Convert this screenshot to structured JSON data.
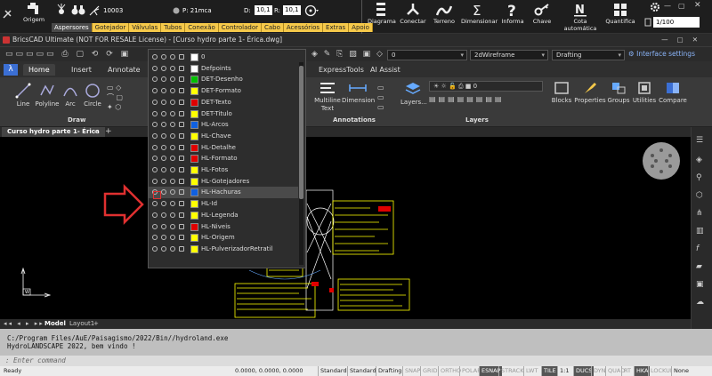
{
  "topbar": {
    "origem": "Origem",
    "counter": "10003",
    "pressure": "P: 21mca",
    "d_label": "D:",
    "d_value": "10,1",
    "r_label": "R:",
    "r_value": "10,1",
    "menus": [
      "Aspersores",
      "Gotejador",
      "Válvulas",
      "Tubos",
      "Conexão",
      "Controlador",
      "Cabo",
      "Acessórios",
      "Extras",
      "Apoio"
    ],
    "active_menu": "Aspersores",
    "tools": [
      "Diagrama",
      "Conectar",
      "Terreno",
      "Dimensionar",
      "Informa",
      "Chave",
      "Cota automática",
      "Quantifica"
    ],
    "scale": "1/100"
  },
  "titlebar": {
    "title": "BricsCAD Ultimate (NOT FOR RESALE License) - [Curso hydro parte 1- Érica.dwg]"
  },
  "qabar": {
    "layer_combo": "0",
    "visual_style": "2dWireframe",
    "workspace": "Drafting",
    "interface_settings": "Interface settings"
  },
  "tabs": [
    "Home",
    "Insert",
    "Annotate",
    "ExpressTools",
    "AI Assist"
  ],
  "ribbon": {
    "draw_tools": [
      "Line",
      "Polyline",
      "Arc",
      "Circle"
    ],
    "draw_group": "Draw",
    "annotation_tools": [
      "Multiline Text",
      "Dimension"
    ],
    "annotations_group": "Annotations",
    "layers_btn": "Layers...",
    "layers_group": "Layers",
    "layer_combo": "0",
    "right_tools": [
      "Blocks",
      "Properties",
      "Groups",
      "Utilities",
      "Compare"
    ]
  },
  "doc_tab": "Curso hydro parte 1- Érica",
  "layers": [
    {
      "name": "0",
      "color": "#ffffff"
    },
    {
      "name": "Defpoints",
      "color": "#ffffff"
    },
    {
      "name": "DET-Desenho",
      "color": "#00c000"
    },
    {
      "name": "DET-Formato",
      "color": "#ffff00"
    },
    {
      "name": "DET-Texto",
      "color": "#e00000"
    },
    {
      "name": "DET-Titulo",
      "color": "#ffff00"
    },
    {
      "name": "HL-Arcos",
      "color": "#1060e0"
    },
    {
      "name": "HL-Chave",
      "color": "#ffff00"
    },
    {
      "name": "HL-Detalhe",
      "color": "#e00000"
    },
    {
      "name": "HL-Formato",
      "color": "#e00000"
    },
    {
      "name": "HL-Fotos",
      "color": "#ffff00"
    },
    {
      "name": "HL-Gotejadores",
      "color": "#ffff00"
    },
    {
      "name": "HL-Hachuras",
      "color": "#1060e0"
    },
    {
      "name": "HL-Id",
      "color": "#ffff00"
    },
    {
      "name": "HL-Legenda",
      "color": "#ffff00"
    },
    {
      "name": "HL-Niveis",
      "color": "#e00000"
    },
    {
      "name": "HL-Origem",
      "color": "#ffff00"
    },
    {
      "name": "HL-PulverizadorRetratil",
      "color": "#ffff00"
    }
  ],
  "selected_layer": "HL-Hachuras",
  "layout_tabs": [
    "Model",
    "Layout1",
    "+"
  ],
  "console": {
    "line1": "C:/Program Files/AuE/Paisagismo/2022/Bin//hydroland.exe",
    "line2": "HydroLANDSCAPE 2022, bem vindo !"
  },
  "cmd_placeholder": ": Enter command",
  "status": {
    "ready": "Ready",
    "coords": "0.0000, 0.0000, 0.0000",
    "items": [
      "Standard",
      "Standard",
      "Drafting",
      "SNAP",
      "GRID",
      "ORTHO",
      "POLAR",
      "ESNAP",
      "STRACK",
      "LWT",
      "TILE",
      "1:1",
      "DUCS",
      "DYN",
      "QUAD",
      "RT",
      "HKA",
      "LOCKUI",
      "None"
    ]
  }
}
